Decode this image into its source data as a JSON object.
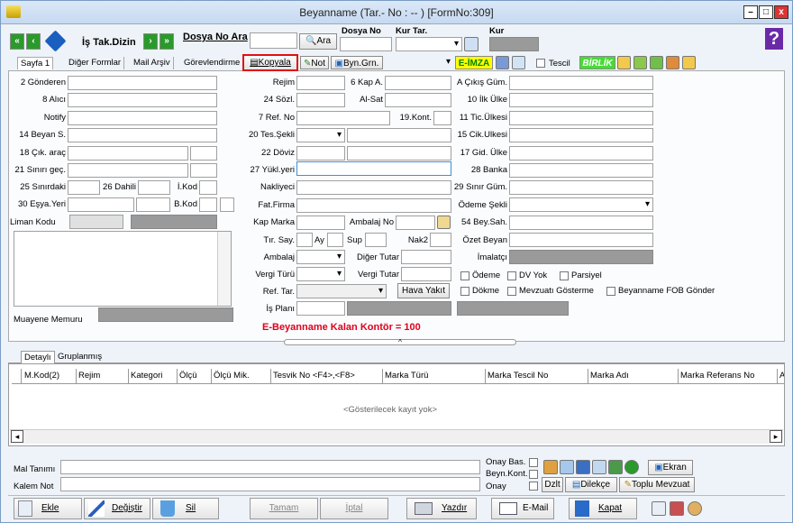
{
  "window": {
    "title": "Beyanname (Tar.- No : -- ) [FormNo:309]"
  },
  "toolbar": {
    "is_tak_dizin": "İş Tak.Dizin",
    "dosya_no_ara": "Dosya No Ara",
    "ara": "Ara",
    "dosya_no": "Dosya No",
    "kur_tar": "Kur Tar.",
    "kur": "Kur"
  },
  "tabs": [
    "Sayfa 1",
    "Diğer Formlar",
    "Mail Arşiv",
    "Görevlendirme"
  ],
  "actions": {
    "kopyala": "Kopyala",
    "not": "Not",
    "byn_grn": "Byn.Grn.",
    "eimza": "E-İMZA",
    "tescil": "Tescil",
    "birlik": "BİRLİK"
  },
  "left_labels": {
    "gonderen": "2 Gönderen",
    "alici": "8 Alıcı",
    "notify": "Notify",
    "beyan": "14 Beyan S.",
    "cik_arac": "18 Çık. araç",
    "sinir_gec": "21 Sınırı geç.",
    "sinirdaki": "25 Sınırdaki",
    "dahili": "26 Dahili",
    "ikod": "İ.Kod",
    "esya_yeri": "30 Eşya.Yeri",
    "bkod": "B.Kod",
    "liman": "Liman Kodu",
    "muayene": "Muayene Memuru"
  },
  "mid_labels": {
    "rejim": "Rejim",
    "kap_a": "6 Kap A.",
    "sozl": "24 Sözl.",
    "alsat": "Al-Sat",
    "ref_no": "7 Ref. No",
    "kont": "19.Kont.",
    "tes_sekli": "20 Tes.Şekli",
    "doviz": "22 Döviz",
    "yukl": "27 Yükl.yeri",
    "nakliyeci": "Nakliyeci",
    "fat_firma": "Fat.Firma",
    "kap_marka": "Kap Marka",
    "ambalaj_no": "Ambalaj No",
    "tir_say": "Tır. Say.",
    "ay": "Ay",
    "sup": "Sup",
    "nak2": "Nak2",
    "ambalaj": "Ambalaj",
    "diger_tutar": "Diğer Tutar",
    "vergi_turu": "Vergi Türü",
    "vergi_tutar": "Vergi Tutar",
    "ref_tar": "Ref. Tar.",
    "hava_yakit": "Hava Yakıt",
    "is_plani": "İş Planı"
  },
  "right_labels": {
    "cikis_gum": "A Çıkış Güm.",
    "ilk_ulke": "10 İlk Ülke",
    "tic_ulkesi": "11 Tic.Ülkesi",
    "cik_ulkesi": "15 Cik.Ulkesi",
    "gid_ulke": "17 Gid. Ülke",
    "banka": "28 Banka",
    "sinir_gum": "29 Sınır Güm.",
    "odeme_sekli": "Ödeme Şekli",
    "bey_sah": "54 Bey.Sah.",
    "ozet_beyan": "Özet Beyan",
    "imalatci": "İmalatçı"
  },
  "checks": {
    "odeme": "Ödeme",
    "dv_yok": "DV Yok",
    "parsiyel": "Parsiyel",
    "dokme": "Dökme",
    "mevzuat": "Mevzuatı Gösterme",
    "fob": "Beyanname FOB Gönder"
  },
  "kontor": "E-Beyanname Kalan Kontör = 100",
  "grid": {
    "tabs": [
      "Detaylı",
      "Gruplanmış"
    ],
    "columns": [
      "M.Kod(2)",
      "Rejim",
      "Kategori",
      "Ölçü",
      "Ölçü Mik.",
      "Tesvik No <F4>,<F8>",
      "Marka Türü",
      "Marka Tescil No",
      "Marka Adı",
      "Marka Referans No",
      "A"
    ],
    "empty": "<Gösterilecek kayıt yok>"
  },
  "bottom": {
    "mal_tanimi": "Mal Tanımı",
    "kalem_not": "Kalem Not",
    "onay_bas": "Onay Bas.",
    "beyn_kont": "Beyn.Kont.",
    "onay": "Onay",
    "ekran": "Ekran",
    "dzlt": "Dzlt",
    "dilekce": "Dilekçe",
    "toplu": "Toplu Mevzuat"
  },
  "buttons": {
    "ekle": "Ekle",
    "degistir": "Değiştir",
    "sil": "Sil",
    "tamam": "Tamam",
    "iptal": "İptal",
    "yazdir": "Yazdır",
    "email": "E-Mail",
    "kapat": "Kapat"
  },
  "colors": {
    "kontor": "#e0001b",
    "eimza_bg": "#ffff00",
    "eimza_fg": "#008000",
    "birlik_bg": "#44dd33"
  }
}
